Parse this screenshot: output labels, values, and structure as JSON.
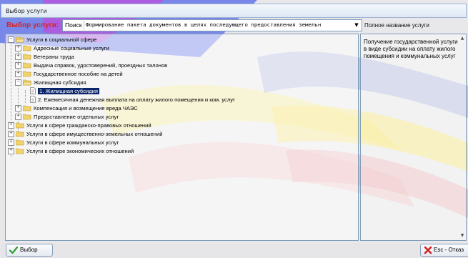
{
  "window": {
    "title": "Выбор услуги"
  },
  "toolbar": {
    "select_label": "Выбор услуги:",
    "search_label": "Поиск",
    "search_value": "Формирование пакета документов в целях последующего предоставления земельн",
    "fullname_label": "Полное название услуги"
  },
  "tree": {
    "items": [
      {
        "label": "Услуги в социальной сфере",
        "depth": 0,
        "kind": "folder",
        "expanded": true
      },
      {
        "label": "Адресные социальные услуги",
        "depth": 1,
        "kind": "folder",
        "expanded": false
      },
      {
        "label": "Ветераны труда",
        "depth": 1,
        "kind": "folder",
        "expanded": false
      },
      {
        "label": "Выдача справок, удостоверений, проездных талонов",
        "depth": 1,
        "kind": "folder",
        "expanded": false
      },
      {
        "label": "Государственное пособие на детей",
        "depth": 1,
        "kind": "folder",
        "expanded": false
      },
      {
        "label": "Жилищная субсидия",
        "depth": 1,
        "kind": "folder",
        "expanded": true
      },
      {
        "label": "1. Жилищная субсидия",
        "depth": 2,
        "kind": "doc",
        "selected": true
      },
      {
        "label": "2. Ежемесячная денежная выплата на оплату жилого помещения и ком. услуг",
        "depth": 2,
        "kind": "doc"
      },
      {
        "label": "Компенсация и возмещение вреда ЧАЭС",
        "depth": 1,
        "kind": "folder",
        "expanded": false
      },
      {
        "label": "Предоставление отдельных услуг",
        "depth": 1,
        "kind": "folder",
        "expanded": false
      },
      {
        "label": "Услуги в сфере гражданско-правовых отношений",
        "depth": 0,
        "kind": "folder",
        "expanded": false
      },
      {
        "label": "Услуги в сфере имущественно-земельных отношений",
        "depth": 0,
        "kind": "folder",
        "expanded": false
      },
      {
        "label": "Услуги в сфере коммунальных услуг",
        "depth": 0,
        "kind": "folder",
        "expanded": false
      },
      {
        "label": "Услуги в сфере экономических отношений",
        "depth": 0,
        "kind": "folder",
        "expanded": false
      }
    ]
  },
  "details": {
    "full_name": "Получение государственной услуги в виде субсидии на оплату жилого помещения и коммунальных услуг"
  },
  "footer": {
    "ok_label": "Выбор",
    "cancel_label": "Esc - Отказ"
  },
  "colors": {
    "accent_red": "#d0272a",
    "selection": "#0a246a",
    "folder": "#f2d36b"
  },
  "icons": {
    "ok": "checkmark-icon",
    "cancel": "cross-icon",
    "folder": "folder-icon",
    "document": "document-icon"
  }
}
